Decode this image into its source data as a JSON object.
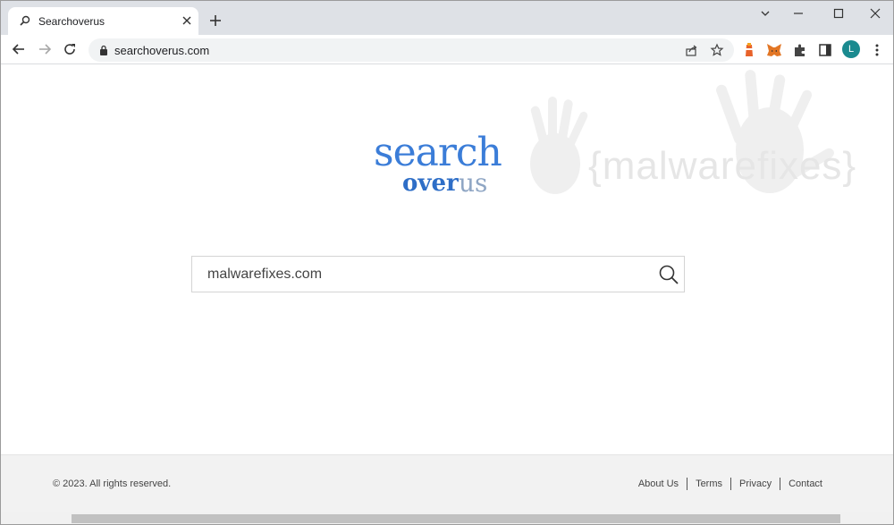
{
  "browser": {
    "tab_title": "Searchoverus",
    "url": "searchoverus.com",
    "avatar_letter": "L"
  },
  "page": {
    "logo": {
      "word1": "search",
      "word2a": "over",
      "word2b": "us"
    },
    "watermark": "{malwarefixes}",
    "search": {
      "value": "malwarefixes.com"
    }
  },
  "footer": {
    "copyright": "© 2023. All rights reserved.",
    "links": [
      "About Us",
      "Terms",
      "Privacy",
      "Contact"
    ]
  },
  "colors": {
    "logo_blue": "#3b7dd8",
    "logo_gray": "#8fa6c4",
    "avatar": "#1a8a8f"
  }
}
